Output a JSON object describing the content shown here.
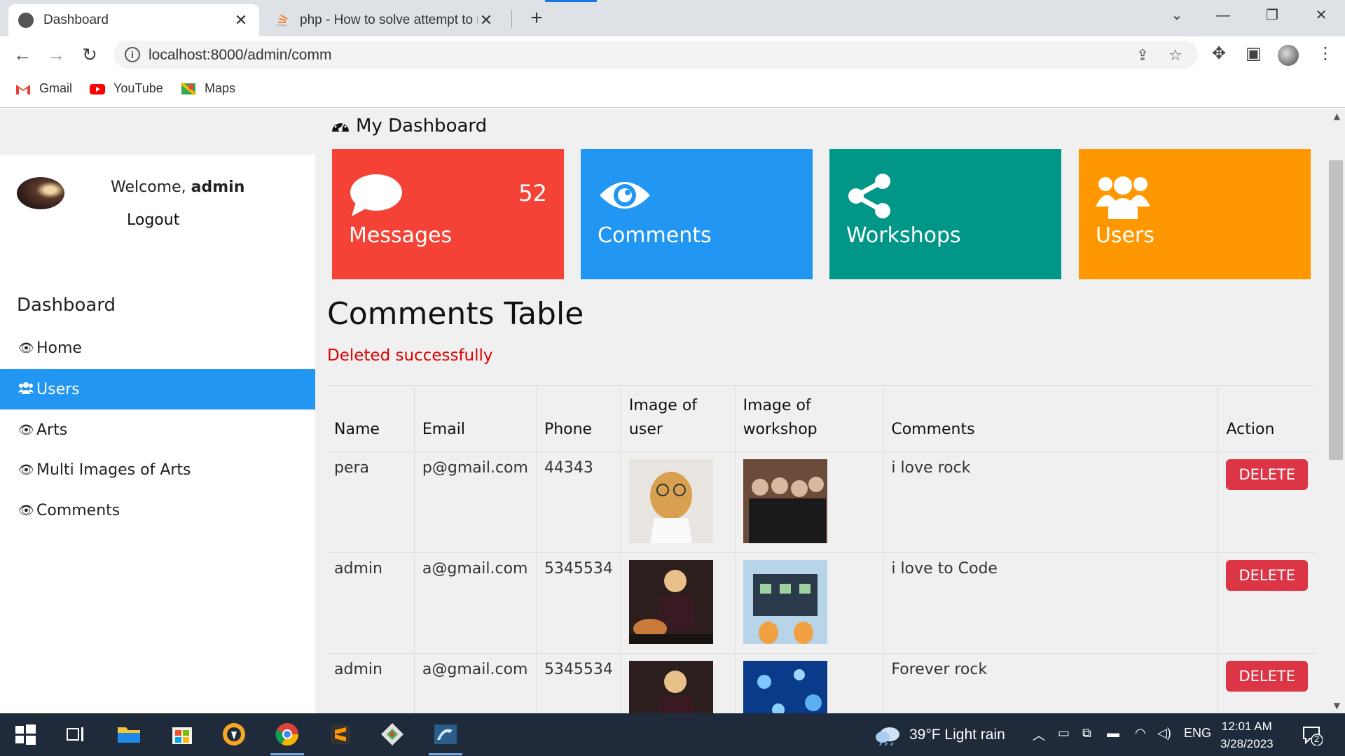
{
  "browser": {
    "tabs": [
      {
        "title": "Dashboard",
        "active": true
      },
      {
        "title": "php - How to solve attempt to re",
        "active": false
      }
    ],
    "url": "localhost:8000/admin/comm",
    "bookmarks": [
      "Gmail",
      "YouTube",
      "Maps"
    ]
  },
  "sidebar": {
    "welcome_prefix": "Welcome,",
    "username": "admin",
    "logout": "Logout",
    "heading": "Dashboard",
    "items": [
      {
        "label": "Home",
        "active": false
      },
      {
        "label": "Users",
        "active": true
      },
      {
        "label": "Arts",
        "active": false
      },
      {
        "label": "Multi Images of Arts",
        "active": false
      },
      {
        "label": "Comments",
        "active": false
      }
    ]
  },
  "dashboard": {
    "title": "My Dashboard",
    "cards": [
      {
        "label": "Messages",
        "count": "52",
        "color": "#f44336",
        "icon": "comment-icon"
      },
      {
        "label": "Comments",
        "count": "",
        "color": "#2196f3",
        "icon": "eye-icon"
      },
      {
        "label": "Workshops",
        "count": "",
        "color": "#009688",
        "icon": "share-icon"
      },
      {
        "label": "Users",
        "count": "",
        "color": "#ff9800",
        "icon": "users-icon"
      }
    ]
  },
  "table": {
    "title": "Comments Table",
    "message": "Deleted successfully",
    "headers": [
      "Name",
      "Email",
      "Phone",
      "Image of user",
      "Image of workshop",
      "Comments",
      "Action"
    ],
    "rows": [
      {
        "name": "pera",
        "email": "p@gmail.com",
        "phone": "44343",
        "comment": "i love rock",
        "action": "DELETE"
      },
      {
        "name": "admin",
        "email": "a@gmail.com",
        "phone": "5345534",
        "comment": "i love to Code",
        "action": "DELETE"
      },
      {
        "name": "admin",
        "email": "a@gmail.com",
        "phone": "5345534",
        "comment": "Forever rock",
        "action": "DELETE"
      }
    ]
  },
  "taskbar": {
    "weather": "39°F  Light rain",
    "lang": "ENG",
    "time": "12:01 AM",
    "date": "3/28/2023",
    "notifications": "2"
  }
}
